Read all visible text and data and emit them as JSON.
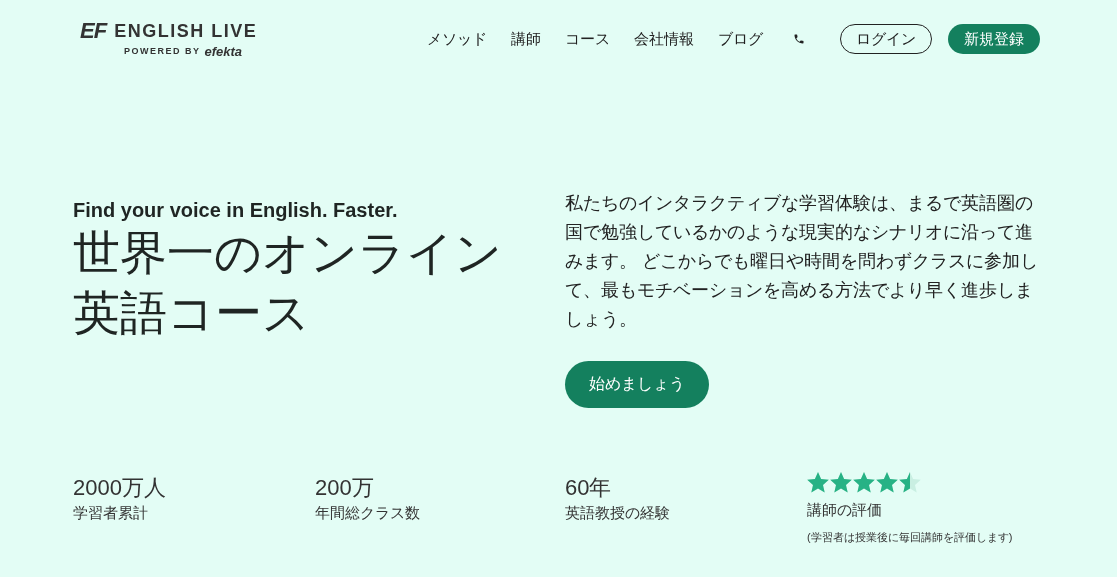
{
  "header": {
    "logo": {
      "mark": "EF",
      "name": "ENGLISH LIVE",
      "powered_by": "POWERED BY",
      "brand": "efekta"
    },
    "nav": [
      "メソッド",
      "講師",
      "コース",
      "会社情報",
      "ブログ"
    ],
    "login": "ログイン",
    "signup": "新規登録"
  },
  "hero": {
    "tagline": "Find your voice in English. Faster.",
    "heading_lines": [
      "世界一のオンライン",
      "英語コース"
    ],
    "description": "私たちのインタラクティブな学習体験は、まるで英語圏の国で勉強しているかのような現実的なシナリオに沿って進みます。 どこからでも曜日や時間を問わずクラスに参加して、最もモチベーションを高める方法でより早く進歩しましょう。",
    "cta": "始めましょう"
  },
  "stats": [
    {
      "kind": "number",
      "value": "2000万人",
      "label": "学習者累計"
    },
    {
      "kind": "number",
      "value": "200万",
      "label": "年間総クラス数"
    },
    {
      "kind": "number",
      "value": "60年",
      "label": "英語教授の経験"
    },
    {
      "kind": "rating",
      "stars": 4.5,
      "label": "講師の評価",
      "note": "(学習者は授業後に毎回講師を評価します)"
    }
  ]
}
